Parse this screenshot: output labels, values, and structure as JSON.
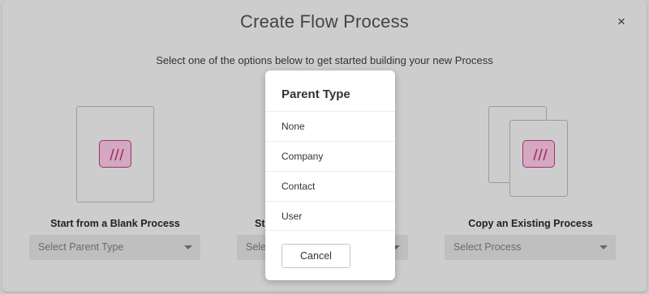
{
  "modal": {
    "title": "Create Flow Process",
    "close_label": "×",
    "subtitle": "Select one of the options below to get started building your new Process"
  },
  "options": [
    {
      "label": "Start from a Blank Process",
      "select_placeholder": "Select Parent Type",
      "icon": "flow-icon"
    },
    {
      "label": "Sta",
      "select_placeholder": "Selec",
      "icon": "flow-icon"
    },
    {
      "label": "Copy an Existing Process",
      "select_placeholder": "Select Process",
      "icon": "flow-icon"
    }
  ],
  "popup": {
    "title": "Parent Type",
    "items": [
      "None",
      "Company",
      "Contact",
      "User"
    ],
    "cancel_label": "Cancel"
  },
  "colors": {
    "overlay": "#c9c9c9",
    "icon_border": "#a0306c",
    "icon_fill": "#d5a8c2",
    "popup_bg": "#ffffff"
  }
}
